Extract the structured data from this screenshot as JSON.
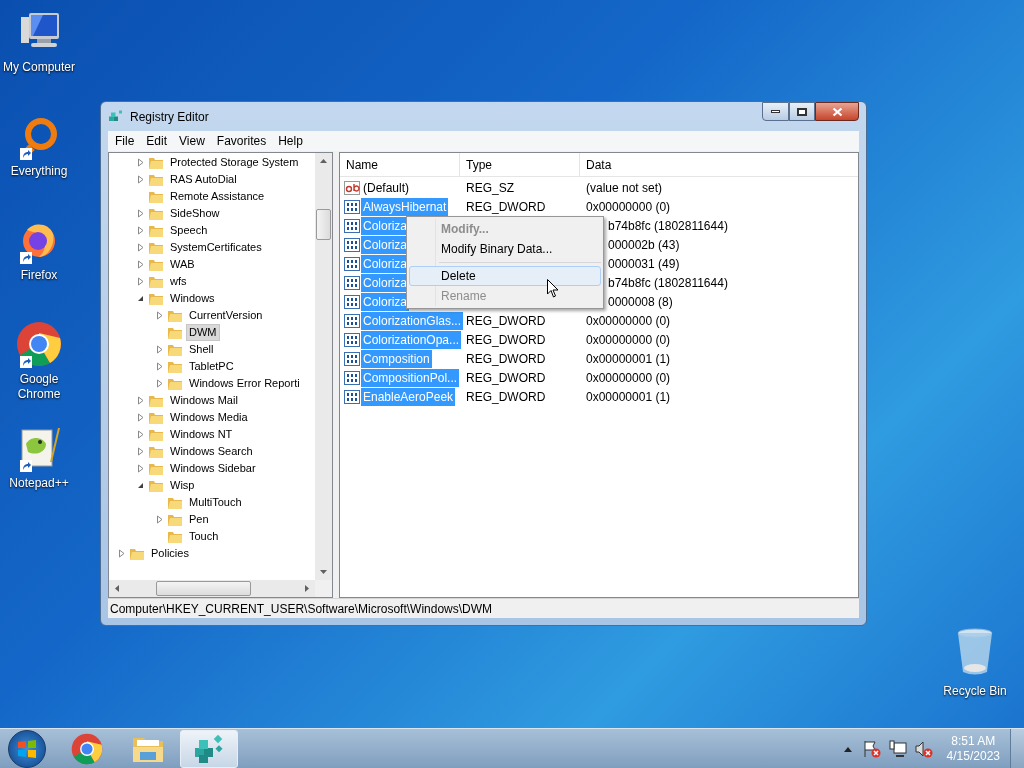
{
  "desktop_icons": [
    {
      "label": "My Computer",
      "kind": "computer",
      "shortcut": false
    },
    {
      "label": "Everything",
      "kind": "everything",
      "shortcut": true
    },
    {
      "label": "Firefox",
      "kind": "firefox",
      "shortcut": true
    },
    {
      "label": "Google Chrome",
      "kind": "chrome",
      "shortcut": true
    },
    {
      "label": "Notepad++",
      "kind": "notepad",
      "shortcut": true
    }
  ],
  "recycle_bin": {
    "label": "Recycle Bin"
  },
  "window": {
    "title": "Registry Editor",
    "menu": [
      "File",
      "Edit",
      "View",
      "Favorites",
      "Help"
    ],
    "tree": {
      "items": [
        {
          "label": "Protected Storage System",
          "expandable": true,
          "expanded": false,
          "selected": false
        },
        {
          "label": "RAS AutoDial",
          "expandable": true,
          "expanded": false,
          "selected": false
        },
        {
          "label": "Remote Assistance",
          "expandable": false,
          "selected": false
        },
        {
          "label": "SideShow",
          "expandable": true,
          "expanded": false,
          "selected": false
        },
        {
          "label": "Speech",
          "expandable": true,
          "expanded": false,
          "selected": false
        },
        {
          "label": "SystemCertificates",
          "expandable": true,
          "expanded": false,
          "selected": false
        },
        {
          "label": "WAB",
          "expandable": true,
          "expanded": false,
          "selected": false
        },
        {
          "label": "wfs",
          "expandable": true,
          "expanded": false,
          "selected": false
        },
        {
          "label": "Windows",
          "expandable": true,
          "expanded": true,
          "selected": false,
          "children": [
            {
              "label": "CurrentVersion",
              "expandable": true,
              "expanded": false,
              "selected": false
            },
            {
              "label": "DWM",
              "expandable": false,
              "selected": true
            },
            {
              "label": "Shell",
              "expandable": true,
              "expanded": false,
              "selected": false
            },
            {
              "label": "TabletPC",
              "expandable": true,
              "expanded": false,
              "selected": false
            },
            {
              "label": "Windows Error Reporti",
              "expandable": true,
              "expanded": false,
              "selected": false
            }
          ]
        },
        {
          "label": "Windows Mail",
          "expandable": true,
          "expanded": false,
          "selected": false
        },
        {
          "label": "Windows Media",
          "expandable": true,
          "expanded": false,
          "selected": false
        },
        {
          "label": "Windows NT",
          "expandable": true,
          "expanded": false,
          "selected": false
        },
        {
          "label": "Windows Search",
          "expandable": true,
          "expanded": false,
          "selected": false
        },
        {
          "label": "Windows Sidebar",
          "expandable": true,
          "expanded": false,
          "selected": false
        },
        {
          "label": "Wisp",
          "expandable": true,
          "expanded": true,
          "selected": false,
          "children": [
            {
              "label": "MultiTouch",
              "expandable": false,
              "selected": false
            },
            {
              "label": "Pen",
              "expandable": true,
              "expanded": false,
              "selected": false
            },
            {
              "label": "Touch",
              "expandable": false,
              "selected": false
            }
          ]
        }
      ],
      "parent_items": [
        {
          "label": "Policies",
          "expandable": true,
          "expanded": false,
          "selected": false
        }
      ]
    },
    "list": {
      "columns": [
        "Name",
        "Type",
        "Data"
      ],
      "rows": [
        {
          "name": "(Default)",
          "kind": "string",
          "type": "REG_SZ",
          "data": "(value not set)",
          "selected": false
        },
        {
          "name": "AlwaysHibernat",
          "kind": "dword",
          "type": "REG_DWORD",
          "data": "0x00000000 (0)",
          "selected": true
        },
        {
          "name": "Coloriza",
          "kind": "dword",
          "data": "b74b8fc (1802811644)",
          "selected": true
        },
        {
          "name": "Coloriza",
          "kind": "dword",
          "data": "000002b (43)",
          "selected": true
        },
        {
          "name": "Coloriza",
          "kind": "dword",
          "data": "0000031 (49)",
          "selected": true
        },
        {
          "name": "Coloriza",
          "kind": "dword",
          "data": "b74b8fc (1802811644)",
          "selected": true
        },
        {
          "name": "Coloriza",
          "kind": "dword",
          "data": "0000008 (8)",
          "selected": true
        },
        {
          "name": "ColorizationGlas...",
          "kind": "dword",
          "type": "REG_DWORD",
          "data": "0x00000000 (0)",
          "selected": true
        },
        {
          "name": "ColorizationOpa...",
          "kind": "dword",
          "type": "REG_DWORD",
          "data": "0x00000000 (0)",
          "selected": true
        },
        {
          "name": "Composition",
          "kind": "dword",
          "type": "REG_DWORD",
          "data": "0x00000001 (1)",
          "selected": true
        },
        {
          "name": "CompositionPol...",
          "kind": "dword",
          "type": "REG_DWORD",
          "data": "0x00000000 (0)",
          "selected": true
        },
        {
          "name": "EnableAeroPeek",
          "kind": "dword",
          "type": "REG_DWORD",
          "data": "0x00000001 (1)",
          "selected": true
        }
      ]
    },
    "context_menu": {
      "items": [
        {
          "kind": "item",
          "label": "Modify...",
          "bold": true,
          "disabled": true,
          "selected": false
        },
        {
          "kind": "item",
          "label": "Modify Binary Data...",
          "bold": false,
          "disabled": false,
          "selected": false
        },
        {
          "kind": "separator"
        },
        {
          "kind": "item",
          "label": "Delete",
          "bold": false,
          "disabled": false,
          "selected": true
        },
        {
          "kind": "item",
          "label": "Rename",
          "bold": false,
          "disabled": true,
          "selected": false
        }
      ]
    },
    "status_bar": "Computer\\HKEY_CURRENT_USER\\Software\\Microsoft\\Windows\\DWM"
  },
  "taskbar": {
    "buttons": [
      {
        "kind": "chrome",
        "active": false
      },
      {
        "kind": "explorer",
        "active": false
      },
      {
        "kind": "regedit",
        "active": true
      }
    ],
    "time": "8:51 AM",
    "date": "4/15/2023"
  }
}
